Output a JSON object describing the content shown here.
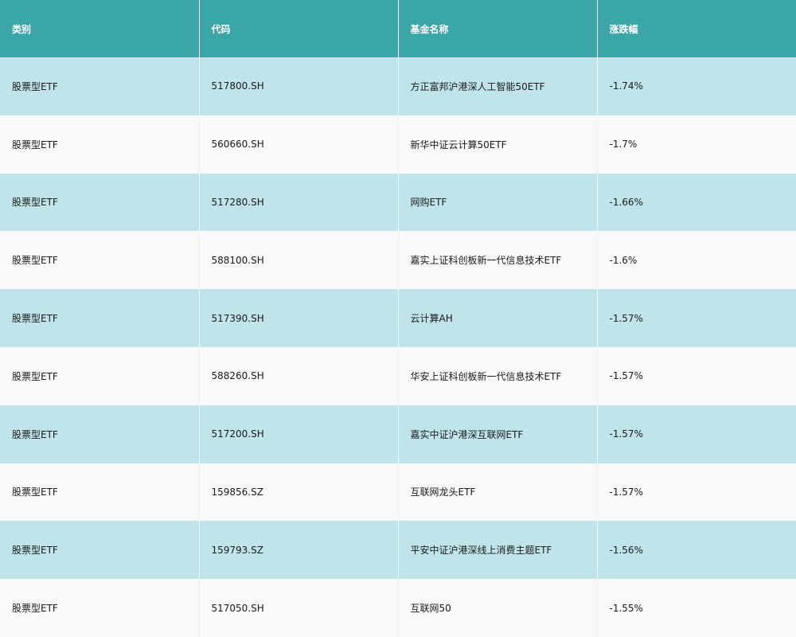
{
  "table": {
    "headers": [
      "类别",
      "代码",
      "基金名称",
      "涨跌幅"
    ],
    "rows": [
      [
        "股票型ETF",
        "517800.SH",
        "方正富邦沪港深人工智能50ETF",
        "-1.74%"
      ],
      [
        "股票型ETF",
        "560660.SH",
        "新华中证云计算50ETF",
        "-1.7%"
      ],
      [
        "股票型ETF",
        "517280.SH",
        "网购ETF",
        "-1.66%"
      ],
      [
        "股票型ETF",
        "588100.SH",
        "嘉实上证科创板新一代信息技术ETF",
        "-1.6%"
      ],
      [
        "股票型ETF",
        "517390.SH",
        "云计算AH",
        "-1.57%"
      ],
      [
        "股票型ETF",
        "588260.SH",
        "华安上证科创板新一代信息技术ETF",
        "-1.57%"
      ],
      [
        "股票型ETF",
        "517200.SH",
        "嘉实中证沪港深互联网ETF",
        "-1.57%"
      ],
      [
        "股票型ETF",
        "159856.SZ",
        "互联网龙头ETF",
        "-1.57%"
      ],
      [
        "股票型ETF",
        "159793.SZ",
        "平安中证沪港深线上消费主题ETF",
        "-1.56%"
      ],
      [
        "股票型ETF",
        "517050.SH",
        "互联网50",
        "-1.55%"
      ]
    ]
  },
  "colors": {
    "header_bg": "#3aa6a7",
    "row_alt_bg": "#bfe4e9",
    "row_bg": "#f7f9fb"
  }
}
